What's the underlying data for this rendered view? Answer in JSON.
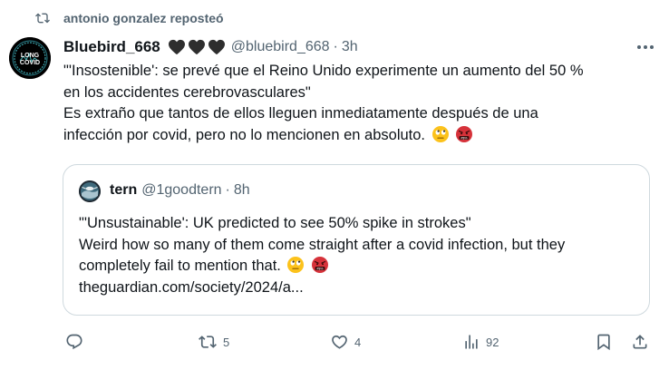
{
  "repost": {
    "text": "antonio gonzalez reposteó",
    "icon": "repost-icon"
  },
  "tweet": {
    "author_name": "Bluebird_668",
    "badges": [
      "black-heart",
      "black-heart",
      "black-heart"
    ],
    "handle": "@bluebird_668",
    "separator": "·",
    "time": "3h",
    "avatar_text_top": "LONG",
    "avatar_text_bottom": "COVID",
    "lines": [
      "\"'Insostenible': se prevé que el Reino Unido experimente un aumento del 50 %",
      "en los accidentes cerebrovasculares\"",
      "Es extraño que tantos de ellos lleguen inmediatamente después de una",
      "infección por covid, pero no lo mencionen en absoluto."
    ],
    "emojis": [
      "face-with-rolling-eyes",
      "face-with-symbols-on-mouth"
    ]
  },
  "quoted": {
    "author_name": "tern",
    "handle": "@1goodtern",
    "separator": "·",
    "time": "8h",
    "lines": [
      "\"'Unsustainable': UK predicted to see 50% spike in strokes\"",
      "Weird how so many of them come straight after a covid infection, but they",
      "completely fail to mention that."
    ],
    "link": "theguardian.com/society/2024/a..."
  },
  "actions": {
    "reply_count": "",
    "repost_count": "5",
    "like_count": "4",
    "views_count": "92"
  },
  "colors": {
    "text": "#0f1419",
    "muted": "#536471",
    "border": "#cfd9de"
  }
}
